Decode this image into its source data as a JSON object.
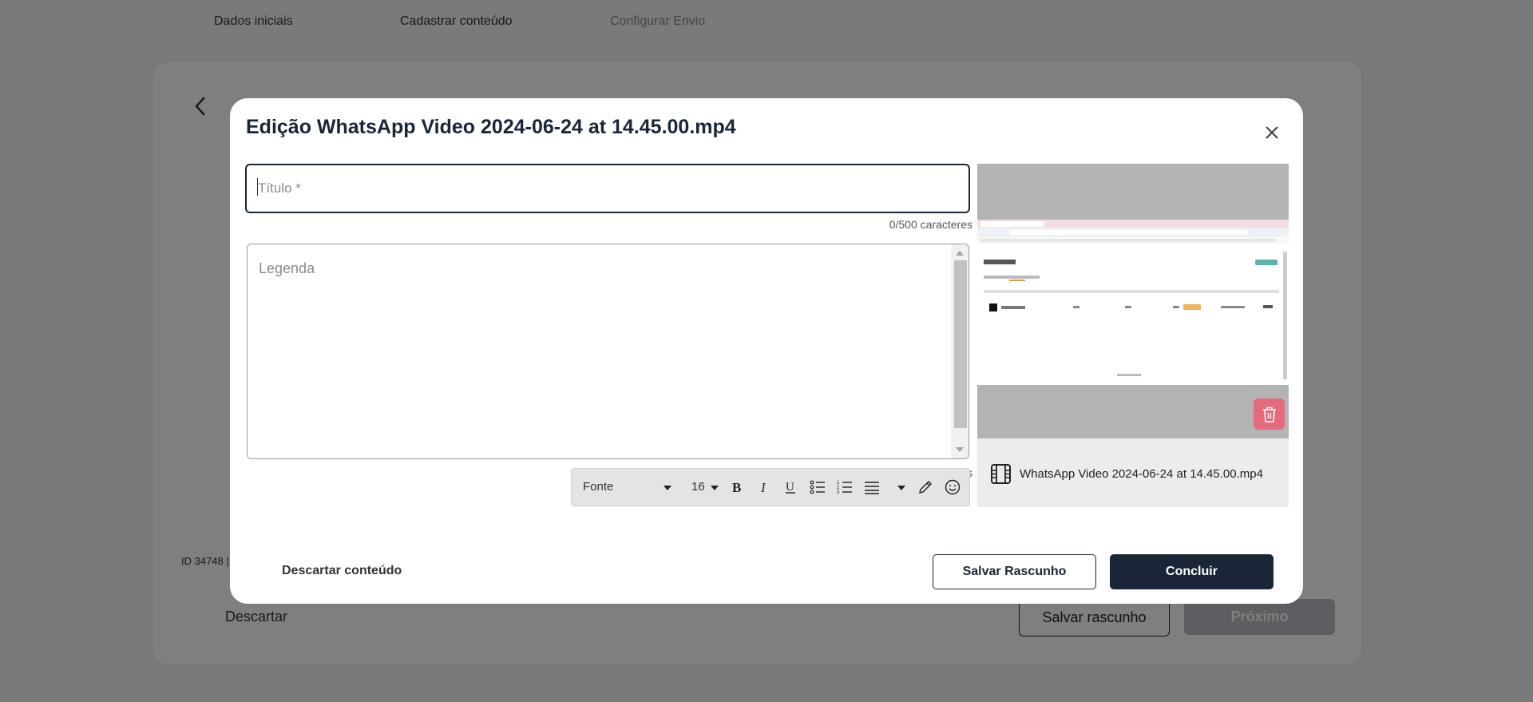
{
  "background": {
    "steps": [
      "Dados iniciais",
      "Cadastrar conteúdo",
      "Configurar Envio"
    ],
    "id_text": "ID 34748 |",
    "discard_label": "Descartar",
    "save_draft_label": "Salvar rascunho",
    "next_label": "Próximo"
  },
  "modal": {
    "title": "Edição WhatsApp Video 2024-06-24 at 14.45.00.mp4",
    "title_field": {
      "placeholder": "Título *",
      "value": "",
      "counter": "0/500 caracteres"
    },
    "caption_field": {
      "placeholder": "Legenda",
      "value": "",
      "counter": "0/2000 caracteres"
    },
    "toolbar": {
      "font_label": "Fonte",
      "size_label": "16",
      "buttons": [
        "bold-icon",
        "italic-icon",
        "underline-icon",
        "bullet-list-icon",
        "numbered-list-icon",
        "align-icon",
        "pencil-icon",
        "emoji-icon"
      ]
    },
    "preview": {
      "file_name": "WhatsApp Video 2024-06-24 at 14.45.00.mp4",
      "file_icon": "film-icon",
      "delete_icon": "trash-icon"
    },
    "actions": {
      "discard_label": "Descartar conteúdo",
      "save_draft_label": "Salvar Rascunho",
      "conclude_label": "Concluir"
    }
  },
  "colors": {
    "primary": "#1b2538",
    "danger": "#e46a7c",
    "overlay": "rgba(0,0,0,0.5)"
  }
}
